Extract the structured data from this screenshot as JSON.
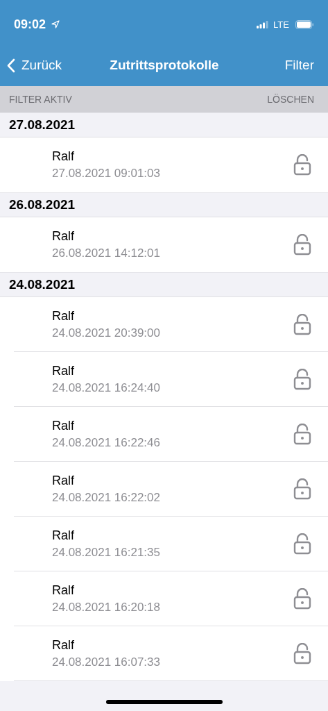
{
  "status_bar": {
    "time": "09:02",
    "network": "LTE"
  },
  "nav_bar": {
    "back": "Zurück",
    "title": "Zutrittsprotokolle",
    "action": "Filter"
  },
  "filter_bar": {
    "label": "FILTER AKTIV",
    "action": "LÖSCHEN"
  },
  "sections": [
    {
      "date": "27.08.2021",
      "entries": [
        {
          "name": "Ralf",
          "timestamp": "27.08.2021 09:01:03"
        }
      ]
    },
    {
      "date": "26.08.2021",
      "entries": [
        {
          "name": "Ralf",
          "timestamp": "26.08.2021 14:12:01"
        }
      ]
    },
    {
      "date": "24.08.2021",
      "entries": [
        {
          "name": "Ralf",
          "timestamp": "24.08.2021 20:39:00"
        },
        {
          "name": "Ralf",
          "timestamp": "24.08.2021 16:24:40"
        },
        {
          "name": "Ralf",
          "timestamp": "24.08.2021 16:22:46"
        },
        {
          "name": "Ralf",
          "timestamp": "24.08.2021 16:22:02"
        },
        {
          "name": "Ralf",
          "timestamp": "24.08.2021 16:21:35"
        },
        {
          "name": "Ralf",
          "timestamp": "24.08.2021 16:20:18"
        },
        {
          "name": "Ralf",
          "timestamp": "24.08.2021 16:07:33"
        }
      ]
    }
  ]
}
